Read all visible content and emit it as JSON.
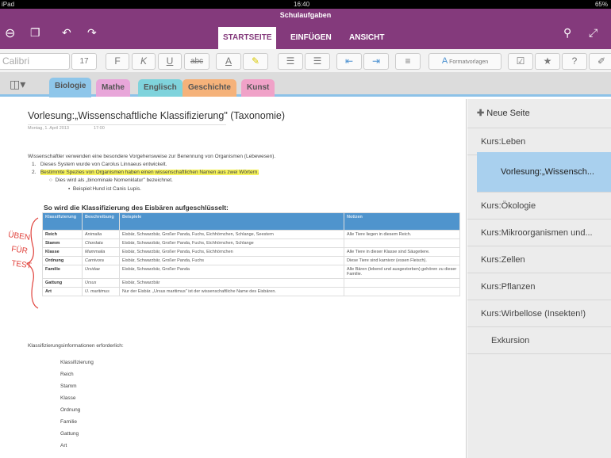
{
  "status": {
    "device": "iPad",
    "time": "16:40",
    "battery": "65%"
  },
  "app": {
    "title": "Schulaufgaben"
  },
  "ribbon_tabs": [
    "STARTSEITE",
    "EINFÜGEN",
    "ANSICHT"
  ],
  "toolbar": {
    "font": "Calibri",
    "size": "17",
    "bold": "F",
    "italic": "K",
    "underline": "U",
    "strike": "abc",
    "color": "A",
    "styles": "Formatvorlagen",
    "help": "?"
  },
  "sections": [
    {
      "label": "Biologie",
      "color": "#8ec6ea"
    },
    {
      "label": "Mathe",
      "color": "#e8a6d9"
    },
    {
      "label": "Englisch",
      "color": "#7fd3dc"
    },
    {
      "label": "Geschichte",
      "color": "#f5b27a"
    },
    {
      "label": "Kunst",
      "color": "#f0a2c8"
    }
  ],
  "note": {
    "title": "Vorlesung:„Wissenschaftliche Klassifizierung\" (Taxonomie)",
    "date": "Montag, 1. April 2013",
    "time": "17:00",
    "intro": "Wissenschaftler verwenden eine besondere Vorgehensweise zur Benennung von Organismen (Lebewesen).",
    "li1": "Dieses System wurde von Carolus Linnaeus entwickelt.",
    "li2": "Bestimmte Spezies von Organismen haben einen wissenschaftlichen Namen aus zwei Wörtern.",
    "sub1": "Dies wird als „binominale Nomenklatur\" bezeichnet.",
    "sub2": "Beispiel:Hund ist Canis Lupis.",
    "table_title": "So wird die Klassifizierung des Eisbären aufgeschlüsselt:",
    "handwriting": "ÜBEN FÜR TEST",
    "columns": [
      "Klassifizierung",
      "Beschreibung",
      "Beispiele",
      "Notizen"
    ],
    "rows": [
      [
        "Reich",
        "Animalia",
        "Eisbär, Schwarzbär, Großer Panda, Fuchs, Eichhörnchen, Schlange, Seestern",
        "Alle Tiere liegen in diesem Reich."
      ],
      [
        "Stamm",
        "Chordata",
        "Eisbär, Schwarzbär, Großer Panda, Fuchs, Eichhörnchen, Schlange",
        ""
      ],
      [
        "Klasse",
        "Mammalia",
        "Eisbär, Schwarzbär, Großer Panda, Fuchs, Eichhörnchen",
        "Alle Tiere in dieser Klasse sind Säugetiere."
      ],
      [
        "Ordnung",
        "Carnivora",
        "Eisbär, Schwarzbär, Großer Panda, Fuchs",
        "Diese Tiere sind karnivor (essen Fleisch)."
      ],
      [
        "Familie",
        "Ursidae",
        "Eisbär, Schwarzbär, Großer Panda",
        "Alle Bären (lebend und ausgestorben) gehören zu dieser Familie."
      ],
      [
        "Gattung",
        "Ursus",
        "Eisbär, Schwarzbär",
        ""
      ],
      [
        "Art",
        "U. maritimus",
        "Nur der Eisbär. „Ursus maritimus\" ist der wissenschaftliche Name des Eisbären.",
        ""
      ]
    ],
    "info_label": "Klassifizierungsinformationen erforderlich:",
    "info_items": [
      "Klassifizierung",
      "Reich",
      "Stamm",
      "Klasse",
      "Ordnung",
      "Familie",
      "Gattung",
      "Art"
    ]
  },
  "sidebar": {
    "new_page": "Neue Seite",
    "pages": [
      "Kurs:Leben",
      "Vorlesung:„Wissensch...",
      "Kurs:Ökologie",
      "Kurs:Mikroorganismen und...",
      "Kurs:Zellen",
      "Kurs:Pflanzen",
      "Kurs:Wirbellose (Insekten!)",
      "Exkursion"
    ],
    "selected": 1
  }
}
